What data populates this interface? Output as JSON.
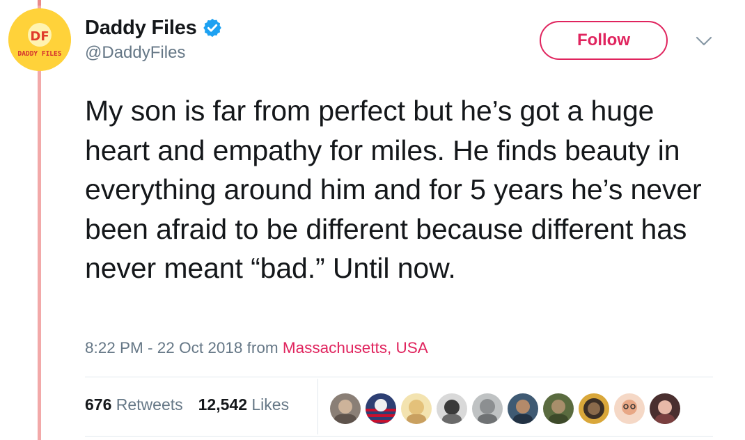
{
  "author": {
    "name": "Daddy Files",
    "handle": "@DaddyFiles",
    "avatar_text": "DADDY FILES",
    "avatar_initials": "DF",
    "verified": true
  },
  "actions": {
    "follow_label": "Follow",
    "more_icon": "chevron-down-icon"
  },
  "tweet": {
    "text": "My son is far from perfect but he’s got a huge heart and empathy for miles. He finds beauty in everything around him and for 5 years he’s never been afraid to be different because different has never meant “bad.” Until now.",
    "timestamp": "8:22 PM - 22 Oct 2018",
    "from_label": "from",
    "location": "Massachusetts, USA"
  },
  "stats": {
    "retweets_count": "676",
    "retweets_label": "Retweets",
    "likes_count": "12,542",
    "likes_label": "Likes"
  },
  "colors": {
    "accent": "#e0245e",
    "verified": "#1da1f2",
    "muted": "#657786",
    "thread_line": "#f2a9a9",
    "avatar_bg": "#ffd23a"
  }
}
